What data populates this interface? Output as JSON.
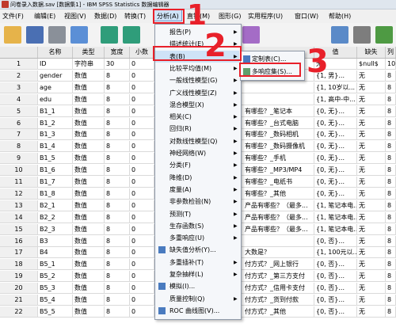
{
  "window": {
    "title": "问卷录入数据.sav [数据集1] - IBM SPSS Statistics 数据编辑器"
  },
  "menubar": {
    "items": [
      {
        "label": "文件(F)"
      },
      {
        "label": "编辑(E)"
      },
      {
        "label": "视图(V)"
      },
      {
        "label": "数据(D)"
      },
      {
        "label": "转换(T)"
      },
      {
        "label": "分析(A)"
      },
      {
        "label": "直销(M)"
      },
      {
        "label": "图形(G)"
      },
      {
        "label": "实用程序(U)"
      },
      {
        "label": "窗口(W)"
      },
      {
        "label": "帮助(H)"
      }
    ]
  },
  "grid": {
    "columns": {
      "name": "名称",
      "type": "类型",
      "width": "宽度",
      "decimals": "小数",
      "values": "值",
      "missing": "缺失",
      "extra": "列"
    },
    "rows": [
      {
        "n": "1",
        "name": "ID",
        "type": "字符串",
        "width": "30",
        "dec": "0",
        "label": "",
        "values": "无",
        "missing": "$null$",
        "extra": "10"
      },
      {
        "n": "2",
        "name": "gender",
        "type": "数值",
        "width": "8",
        "dec": "0",
        "label": "",
        "values": "{1, 男}...",
        "missing": "无",
        "extra": "8"
      },
      {
        "n": "3",
        "name": "age",
        "type": "数值",
        "width": "8",
        "dec": "0",
        "label": "",
        "values": "{1, 10岁以...",
        "missing": "无",
        "extra": "8"
      },
      {
        "n": "4",
        "name": "edu",
        "type": "数值",
        "width": "8",
        "dec": "0",
        "label": "",
        "values": "{1, 高中-中...",
        "missing": "无",
        "extra": "8"
      },
      {
        "n": "5",
        "name": "B1_1",
        "type": "数值",
        "width": "8",
        "dec": "0",
        "label": "有哪些？_笔记本",
        "values": "{0, 无}...",
        "missing": "无",
        "extra": "8"
      },
      {
        "n": "6",
        "name": "B1_2",
        "type": "数值",
        "width": "8",
        "dec": "0",
        "label": "有哪些？_台式电脑",
        "values": "{0, 无}...",
        "missing": "无",
        "extra": "8"
      },
      {
        "n": "7",
        "name": "B1_3",
        "type": "数值",
        "width": "8",
        "dec": "0",
        "label": "有哪些？_数码相机",
        "values": "{0, 无}...",
        "missing": "无",
        "extra": "8"
      },
      {
        "n": "8",
        "name": "B1_4",
        "type": "数值",
        "width": "8",
        "dec": "0",
        "label": "有哪些？_数码摄像机",
        "values": "{0, 无}...",
        "missing": "无",
        "extra": "8"
      },
      {
        "n": "9",
        "name": "B1_5",
        "type": "数值",
        "width": "8",
        "dec": "0",
        "label": "有哪些？_手机",
        "values": "{0, 无}...",
        "missing": "无",
        "extra": "8"
      },
      {
        "n": "10",
        "name": "B1_6",
        "type": "数值",
        "width": "8",
        "dec": "0",
        "label": "有哪些？_MP3/MP4",
        "values": "{0, 无}...",
        "missing": "无",
        "extra": "8"
      },
      {
        "n": "11",
        "name": "B1_7",
        "type": "数值",
        "width": "8",
        "dec": "0",
        "label": "有哪些？_电纸书",
        "values": "{0, 无}...",
        "missing": "无",
        "extra": "8"
      },
      {
        "n": "12",
        "name": "B1_8",
        "type": "数值",
        "width": "8",
        "dec": "0",
        "label": "有哪些？_其他",
        "values": "{0, 无}...",
        "missing": "无",
        "extra": "8"
      },
      {
        "n": "13",
        "name": "B2_1",
        "type": "数值",
        "width": "8",
        "dec": "0",
        "label": "产品有哪些？（最多...",
        "values": "{1, 笔记本电...",
        "missing": "无",
        "extra": "8"
      },
      {
        "n": "14",
        "name": "B2_2",
        "type": "数值",
        "width": "8",
        "dec": "0",
        "label": "产品有哪些？（最多...",
        "values": "{1, 笔记本电...",
        "missing": "无",
        "extra": "8"
      },
      {
        "n": "15",
        "name": "B2_3",
        "type": "数值",
        "width": "8",
        "dec": "0",
        "label": "产品有哪些？（最多...",
        "values": "{1, 笔记本电...",
        "missing": "无",
        "extra": "8"
      },
      {
        "n": "16",
        "name": "B3",
        "type": "数值",
        "width": "8",
        "dec": "0",
        "label": "",
        "values": "{0, 否}...",
        "missing": "无",
        "extra": "8"
      },
      {
        "n": "17",
        "name": "B4",
        "type": "数值",
        "width": "8",
        "dec": "0",
        "label": "大数是？",
        "values": "{1, 100元以...",
        "missing": "无",
        "extra": "8"
      },
      {
        "n": "18",
        "name": "B5_1",
        "type": "数值",
        "width": "8",
        "dec": "0",
        "label": "付方式？_网上银行",
        "values": "{0, 否}...",
        "missing": "无",
        "extra": "8"
      },
      {
        "n": "19",
        "name": "B5_2",
        "type": "数值",
        "width": "8",
        "dec": "0",
        "label": "付方式？_第三方支付",
        "values": "{0, 否}...",
        "missing": "无",
        "extra": "8"
      },
      {
        "n": "20",
        "name": "B5_3",
        "type": "数值",
        "width": "8",
        "dec": "0",
        "label": "付方式？_信用卡支付",
        "values": "{0, 否}...",
        "missing": "无",
        "extra": "8"
      },
      {
        "n": "21",
        "name": "B5_4",
        "type": "数值",
        "width": "8",
        "dec": "0",
        "label": "付方式？_货到付款",
        "values": "{0, 否}...",
        "missing": "无",
        "extra": "8"
      },
      {
        "n": "22",
        "name": "B5_5",
        "type": "数值",
        "width": "8",
        "dec": "0",
        "label": "付方式？_其他",
        "values": "{0, 否}...",
        "missing": "无",
        "extra": "8"
      }
    ]
  },
  "analyze_menu": {
    "items": [
      {
        "label": "报告(P)",
        "has_sub": true,
        "icon": "none"
      },
      {
        "label": "描述统计(E)",
        "has_sub": true,
        "icon": "none"
      },
      {
        "label": "表(B)",
        "has_sub": true,
        "icon": "none"
      },
      {
        "label": "比较平均值(M)",
        "has_sub": true,
        "icon": "none"
      },
      {
        "label": "一般线性模型(G)",
        "has_sub": true,
        "icon": "none"
      },
      {
        "label": "广义线性模型(Z)",
        "has_sub": true,
        "icon": "none"
      },
      {
        "label": "混合模型(X)",
        "has_sub": true,
        "icon": "none"
      },
      {
        "label": "相关(C)",
        "has_sub": true,
        "icon": "none"
      },
      {
        "label": "回归(R)",
        "has_sub": true,
        "icon": "none"
      },
      {
        "label": "对数线性模型(Q)",
        "has_sub": true,
        "icon": "none"
      },
      {
        "label": "神经网络(W)",
        "has_sub": true,
        "icon": "none"
      },
      {
        "label": "分类(F)",
        "has_sub": true,
        "icon": "none"
      },
      {
        "label": "降维(D)",
        "has_sub": true,
        "icon": "none"
      },
      {
        "label": "度量(A)",
        "has_sub": true,
        "icon": "none"
      },
      {
        "label": "非参数检验(N)",
        "has_sub": true,
        "icon": "none"
      },
      {
        "label": "预测(T)",
        "has_sub": true,
        "icon": "none"
      },
      {
        "label": "生存函数(S)",
        "has_sub": true,
        "icon": "none"
      },
      {
        "label": "多重响应(U)",
        "has_sub": true,
        "icon": "none"
      },
      {
        "label": "缺失值分析(Y)...",
        "has_sub": false,
        "icon": "missing-value-icon"
      },
      {
        "label": "多重插补(T)",
        "has_sub": true,
        "icon": "none"
      },
      {
        "label": "复杂抽样(L)",
        "has_sub": true,
        "icon": "none"
      },
      {
        "label": "模拟(I)...",
        "has_sub": false,
        "icon": "simulation-icon"
      },
      {
        "label": "质量控制(Q)",
        "has_sub": true,
        "icon": "none"
      },
      {
        "label": "ROC 曲线图(V)...",
        "has_sub": false,
        "icon": "roc-curve-icon"
      }
    ]
  },
  "tables_submenu": {
    "items": [
      {
        "label": "定制表(C)..."
      },
      {
        "label": "多响应集(S)..."
      }
    ]
  },
  "annotations": {
    "step1": "1",
    "step2": "2",
    "step3": "3"
  },
  "colors": {
    "highlight": "#cfe3f7",
    "annotation": "#e8202a",
    "accent": "#4a7bbf"
  }
}
